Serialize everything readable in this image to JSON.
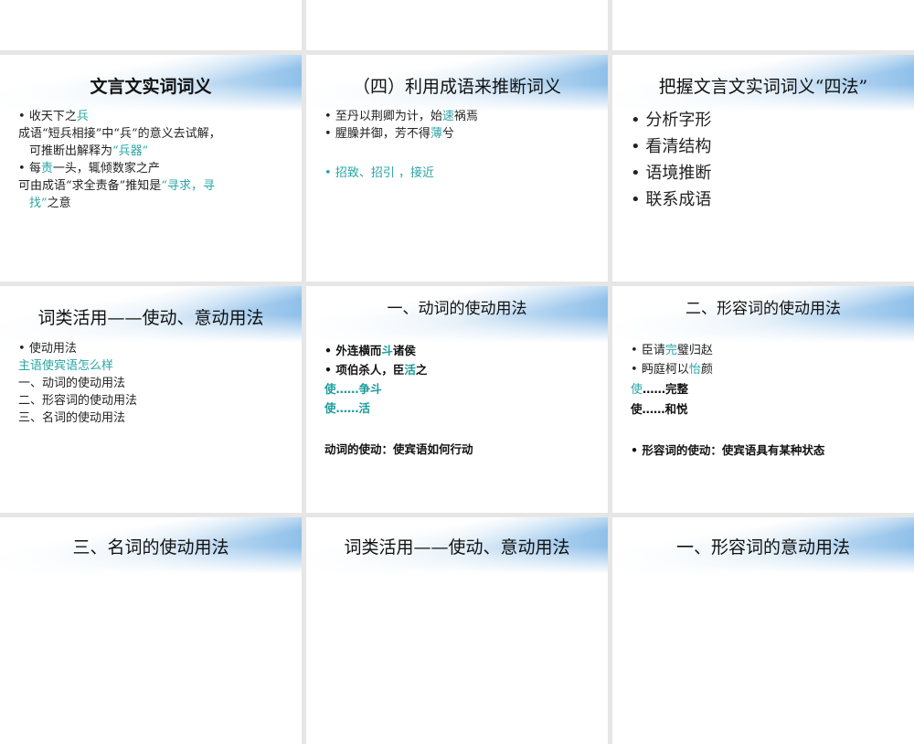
{
  "slides": [
    {
      "title": "文言文实词词义",
      "lines": [
        [
          "收天下之",
          ""
        ],
        [
          "兵",
          ""
        ]
      ],
      "l1a": "收天下之",
      "l1b": "兵",
      "l2a": "成语“短兵相接”中“兵”的意义去试解，",
      "l2b": "可推断出解释为",
      "l2c": "“兵器”",
      "l3a": "每",
      "l3b": "责",
      "l3c": "一头，辄倾数家之产",
      "l4a": "可由成语“求全责备”推知是",
      "l4b": "“寻求，寻",
      "l4c": "找”",
      "l4d": "之意"
    },
    {
      "title": "（四）利用成语来推断词义",
      "l1a": "至丹以荆卿为计，始",
      "l1b": "速",
      "l1c": "祸焉",
      "l2a": "腥臊并御，芳不得",
      "l2b": "薄",
      "l2c": "兮",
      "l3": "招致、招引 ，接近"
    },
    {
      "title": "把握文言文实词词义“四法”",
      "items": [
        "分析字形",
        "看清结构",
        "语境推断",
        "联系成语"
      ]
    },
    {
      "title": "词类活用——使动、意动用法",
      "items": [
        "使动用法",
        "主语使宾语怎么样",
        "一、动词的使动用法",
        "二、形容词的使动用法",
        "三、名词的使动用法"
      ]
    },
    {
      "title": "一、动词的使动用法",
      "l1a": "外连横而",
      "l1b": "斗",
      "l1c": "诸侯",
      "l2a": "项伯杀人，臣",
      "l2b": "活",
      "l2c": "之",
      "l3": "使……争斗",
      "l4": "使……活",
      "l5": "动词的使动：使宾语如何行动"
    },
    {
      "title": "二、形容词的使动用法",
      "l1a": "臣请",
      "l1b": "完",
      "l1c": "璧归赵",
      "l2a": "眄庭柯以",
      "l2b": "怡",
      "l2c": "颜",
      "l3a": "使",
      "l3b": "……完整",
      "l4": "使……和悦",
      "l5": "形容词的使动：使宾语具有某种状态"
    },
    {
      "title": "三、名词的使动用法"
    },
    {
      "title": "词类活用——使动、意动用法"
    },
    {
      "title": "一、形容词的意动用法"
    }
  ]
}
